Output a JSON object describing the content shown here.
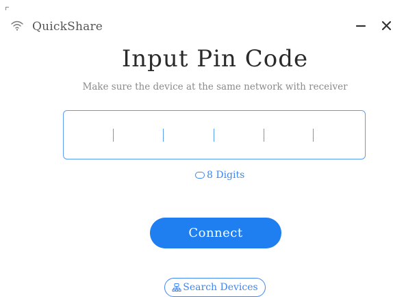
{
  "window": {
    "app_title": "QuickShare",
    "icons": {
      "app": "wifi-icon",
      "minimize": "minimize-icon",
      "close": "close-icon"
    }
  },
  "main": {
    "heading": "Input Pin Code",
    "subheading": "Make sure the device at the same network with receiver",
    "pin_input": {
      "value": "",
      "slots": 5
    },
    "digit_toggle": {
      "label": "8 Digits",
      "icon": "oval-toggle-icon"
    },
    "connect_label": "Connect",
    "search_devices": {
      "label": "Search Devices",
      "icon": "search-devices-icon"
    }
  },
  "colors": {
    "accent": "#1f7ef0",
    "link": "#3d86f0",
    "input_border": "#5a9cf4",
    "text": "#2a2a2a",
    "muted": "#8a8a8a"
  }
}
